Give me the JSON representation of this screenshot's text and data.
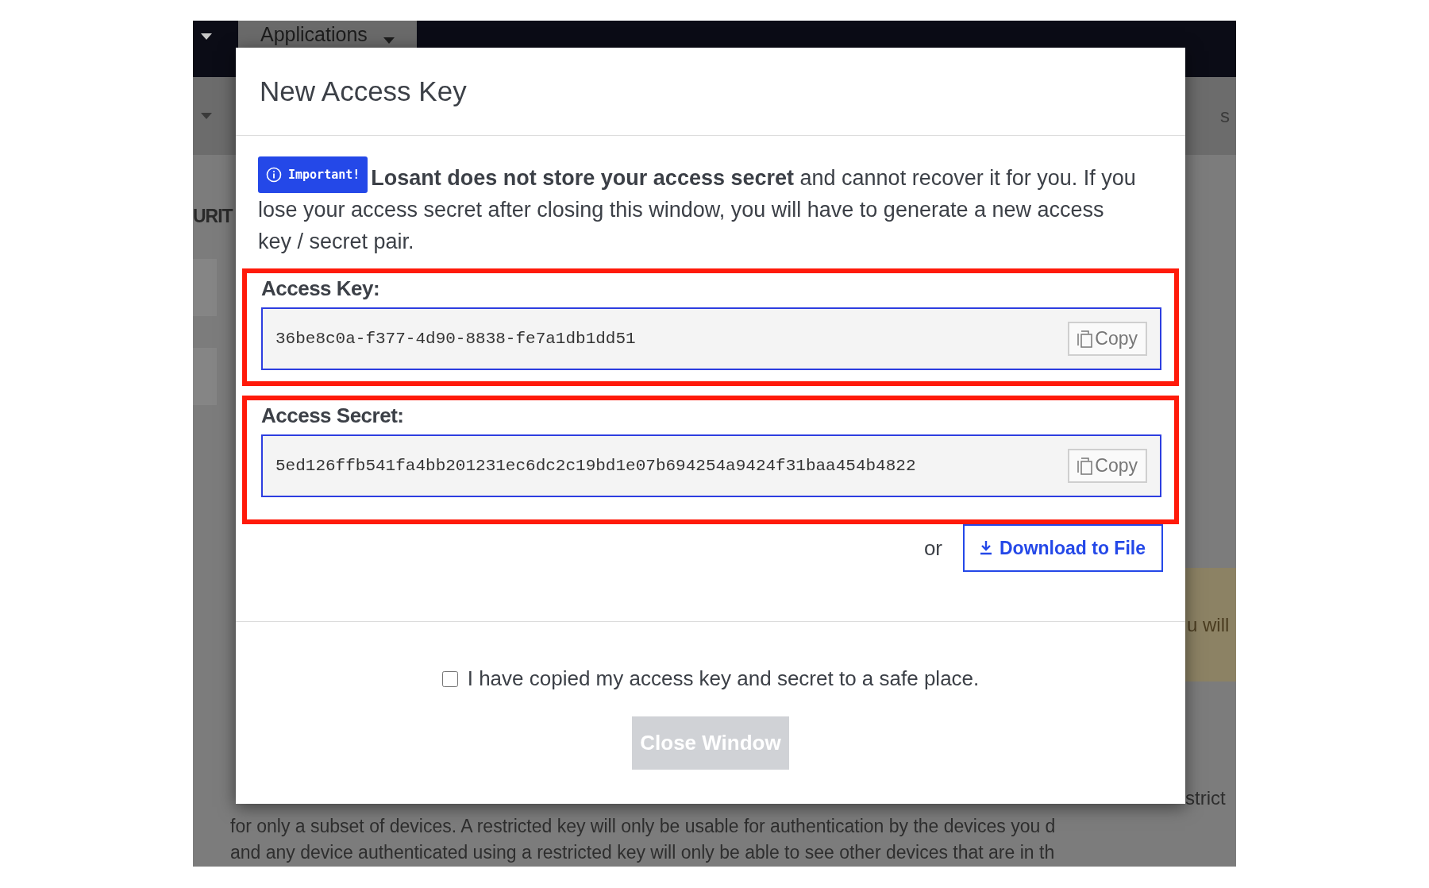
{
  "nav": {
    "tab": "Applications"
  },
  "background": {
    "right_fragment": "s",
    "heading_fragment": "URIT",
    "notice_fragment": "u will",
    "paragraph_fragment": "strict",
    "paragraph_lines": [
      "for only a subset of devices. A restricted key will only be usable for authentication by the devices you d",
      "and any device authenticated using a restricted key will only be able to see other devices that are in th"
    ]
  },
  "modal": {
    "title": "New Access Key",
    "badge": "Important!",
    "notice": "**Losant does not store your access secret** and cannot recover it for you. If you lose your access secret after closing this window, you will have to generate a new access key / secret pair.",
    "fields": [
      {
        "label": "Access Key:",
        "value": "36be8c0a-f377-4d90-8838-fe7a1db1dd51",
        "button": "Copy",
        "highlighted": true
      },
      {
        "label": "Access Secret:",
        "value": "5ed126ffb541fa4bb201231ec6dc2c19bd1e07b694254a9424f31baa454b4822",
        "button": "Copy",
        "highlighted": true
      }
    ],
    "or": "or",
    "download_button": "Download to File",
    "confirm": {
      "label": "I have copied my access key and secret to a safe place.",
      "checked": false
    },
    "close_button": {
      "label": "Close Window",
      "disabled": true
    }
  }
}
